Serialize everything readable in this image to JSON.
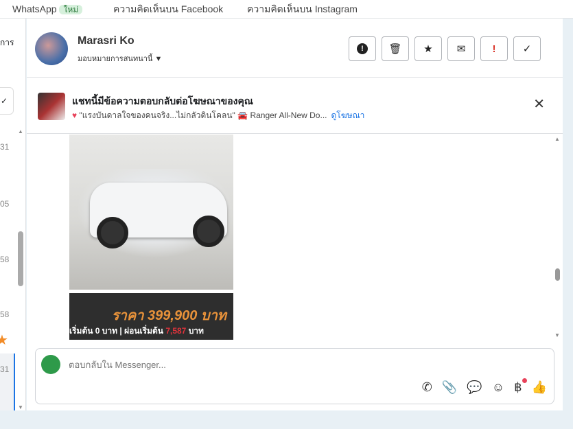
{
  "topbar": {
    "tabs": [
      "WhatsApp",
      "ความคิดเห็นบน Facebook",
      "ความคิดเห็นบน Instagram"
    ],
    "new_badge": "ใหม่"
  },
  "leftcol": {
    "header_text": "การ",
    "times": [
      "31",
      "05",
      "58",
      "58",
      "31"
    ]
  },
  "header": {
    "name": "Marasri Ko",
    "assign": "มอบหมายการสนทนานี้"
  },
  "ad": {
    "title": "แชทนี้มีข้อความตอบกลับต่อโฆษณาของคุณ",
    "text": "\"แรงบันดาลใจของคนจริง...ไม่กลัวดินโคลน\"",
    "product": "Ranger All-New Do...",
    "link": "ดูโฆษณา"
  },
  "message": {
    "price": "ราคา 399,900 บาท",
    "terms_a": "เริ่มต้น 0 บาท | ผ่อนเริ่มต้น ",
    "terms_amount": "7,587",
    "terms_b": " บาท"
  },
  "composer": {
    "placeholder": "ตอบกลับใน Messenger..."
  }
}
